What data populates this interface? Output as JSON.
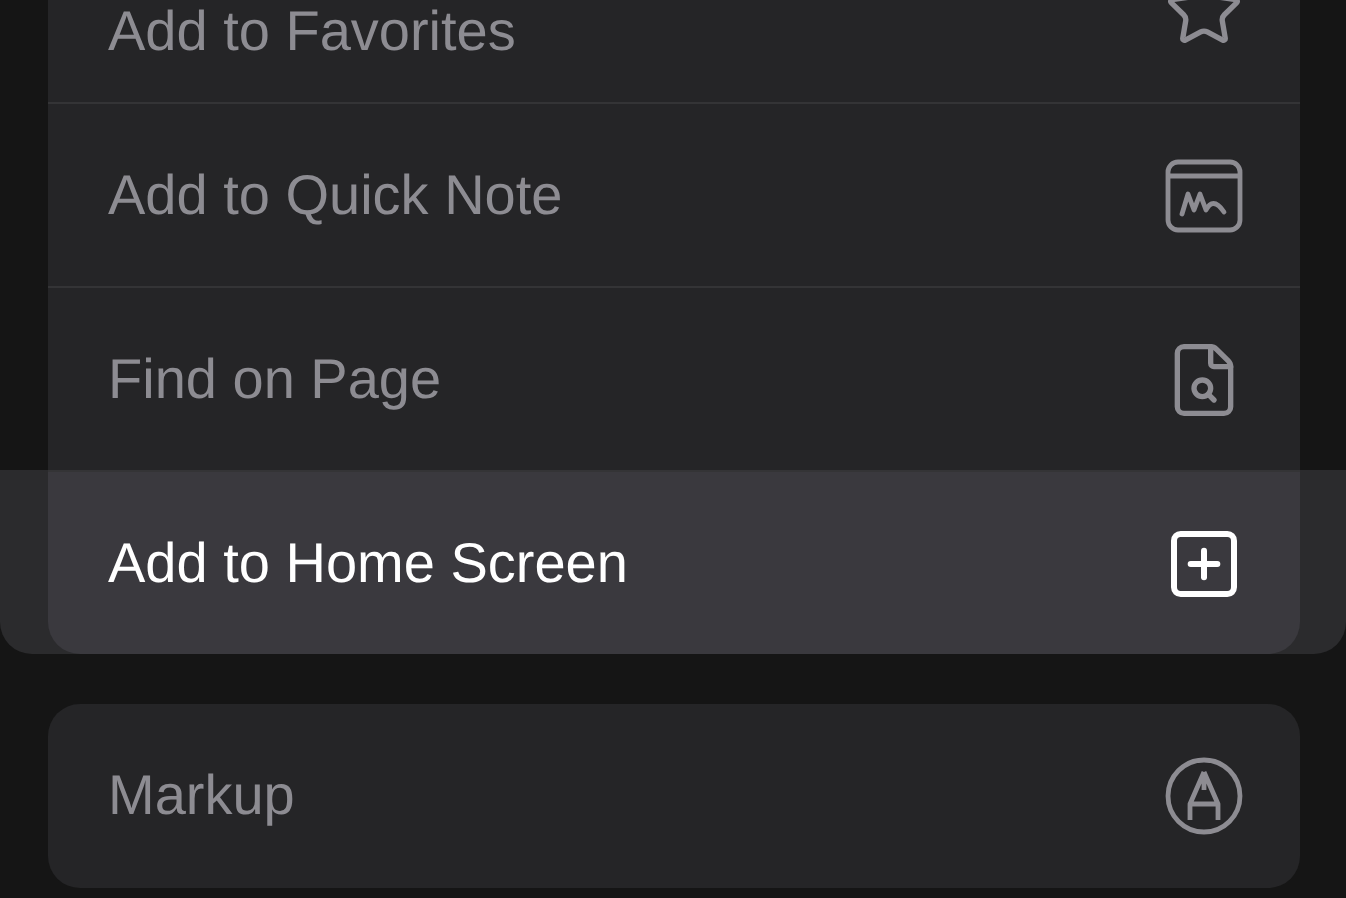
{
  "sections": [
    {
      "items": [
        {
          "label": "Add to Favorites",
          "selected": false
        },
        {
          "label": "Add to Quick Note",
          "selected": false
        },
        {
          "label": "Find on Page",
          "selected": false
        },
        {
          "label": "Add to Home Screen",
          "selected": true
        }
      ]
    },
    {
      "items": [
        {
          "label": "Markup",
          "selected": false
        }
      ]
    }
  ]
}
